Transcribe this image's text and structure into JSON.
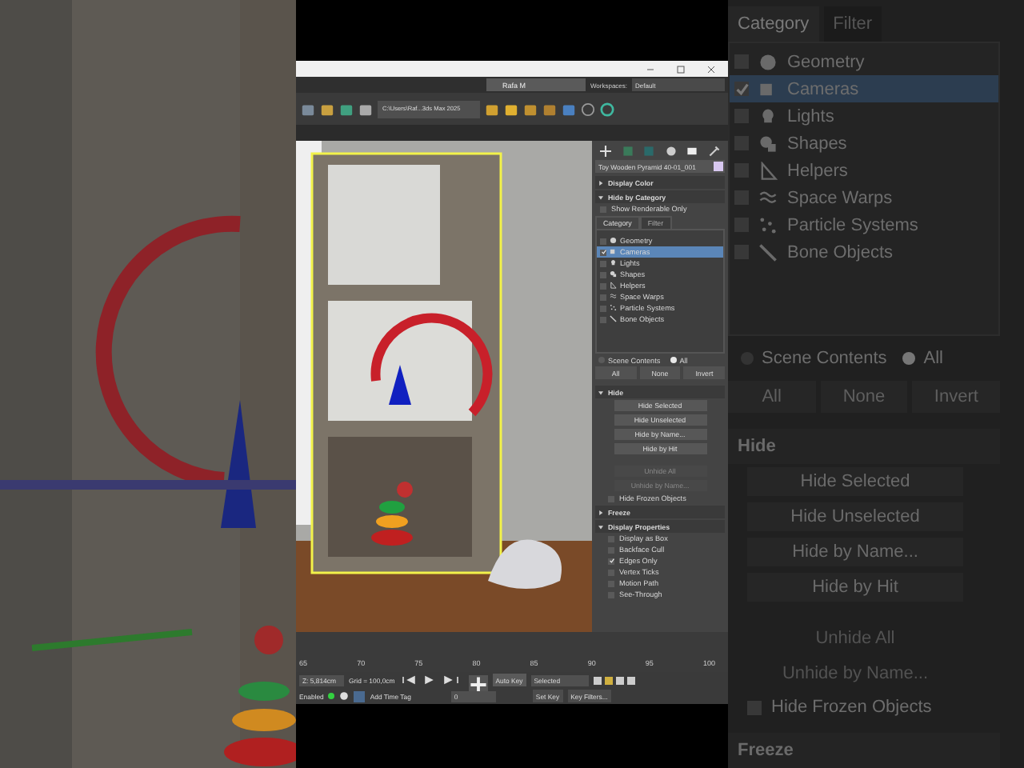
{
  "menu_bar": {
    "user": "Rafa M",
    "workspaces_label": "Workspaces:",
    "workspace": "Default"
  },
  "toolbar": {
    "project_path": "C:\\Users\\Raf...3ds Max 2025"
  },
  "command_panel": {
    "object_name": "Toy Wooden Pyramid 40-01_001",
    "rollouts": [
      {
        "title": "Display Color",
        "expanded": false
      },
      {
        "title": "Hide by Category",
        "expanded": true
      }
    ],
    "show_renderable_only": {
      "label": "Show Renderable Only",
      "checked": false
    },
    "tabs": [
      {
        "label": "Category",
        "selected": true
      },
      {
        "label": "Filter",
        "selected": false
      }
    ],
    "categories": [
      {
        "label": "Geometry",
        "checked": false,
        "selected": false
      },
      {
        "label": "Cameras",
        "checked": true,
        "selected": true
      },
      {
        "label": "Lights",
        "checked": false,
        "selected": false
      },
      {
        "label": "Shapes",
        "checked": false,
        "selected": false
      },
      {
        "label": "Helpers",
        "checked": false,
        "selected": false
      },
      {
        "label": "Space Warps",
        "checked": false,
        "selected": false
      },
      {
        "label": "Particle Systems",
        "checked": false,
        "selected": false
      },
      {
        "label": "Bone Objects",
        "checked": false,
        "selected": false
      }
    ],
    "scope": [
      {
        "label": "Scene Contents",
        "selected": false
      },
      {
        "label": "All",
        "selected": true
      }
    ],
    "select_buttons": [
      "All",
      "None",
      "Invert"
    ],
    "hide": {
      "title": "Hide",
      "expanded": true,
      "buttons": [
        {
          "label": "Hide Selected",
          "disabled": false
        },
        {
          "label": "Hide Unselected",
          "disabled": false
        },
        {
          "label": "Hide by Name...",
          "disabled": false
        },
        {
          "label": "Hide by Hit",
          "disabled": false
        },
        {
          "label": "Unhide All",
          "disabled": true
        },
        {
          "label": "Unhide by Name...",
          "disabled": true
        }
      ],
      "hide_frozen": {
        "label": "Hide Frozen Objects",
        "checked": false
      }
    },
    "freeze": {
      "title": "Freeze",
      "expanded": false
    },
    "display_properties": {
      "title": "Display Properties",
      "expanded": true,
      "options": [
        {
          "label": "Display as Box",
          "checked": false
        },
        {
          "label": "Backface Cull",
          "checked": false
        },
        {
          "label": "Edges Only",
          "checked": true
        },
        {
          "label": "Vertex Ticks",
          "checked": false
        },
        {
          "label": "Motion Path",
          "checked": false
        },
        {
          "label": "See-Through",
          "checked": false
        }
      ]
    }
  },
  "timeline": {
    "ticks": [
      "65",
      "70",
      "75",
      "80",
      "85",
      "90",
      "95",
      "100"
    ]
  },
  "status_bar": {
    "z_value": "Z: 5,814cm",
    "grid": "Grid = 100,0cm",
    "enabled": "Enabled",
    "add_time_tag": "Add Time Tag",
    "frame": "0",
    "auto_key": "Auto Key",
    "key_mode": "Selected",
    "set_key": "Set Key",
    "key_filters": "Key Filters..."
  },
  "backdrop_panel": {
    "tabs": [
      {
        "label": "Category",
        "selected": true
      },
      {
        "label": "Filter",
        "selected": false
      }
    ],
    "categories": [
      {
        "label": "Geometry",
        "checked": false,
        "selected": false
      },
      {
        "label": "Cameras",
        "checked": true,
        "selected": true
      },
      {
        "label": "Lights",
        "checked": false,
        "selected": false
      },
      {
        "label": "Shapes",
        "checked": false,
        "selected": false
      },
      {
        "label": "Helpers",
        "checked": false,
        "selected": false
      },
      {
        "label": "Space Warps",
        "checked": false,
        "selected": false
      },
      {
        "label": "Particle Systems",
        "checked": false,
        "selected": false
      },
      {
        "label": "Bone Objects",
        "checked": false,
        "selected": false
      }
    ],
    "scope": [
      {
        "label": "Scene Contents",
        "selected": false
      },
      {
        "label": "All",
        "selected": true
      }
    ],
    "select_buttons": [
      "All",
      "None",
      "Invert"
    ],
    "hide_title": "Hide",
    "hide_buttons": [
      {
        "label": "Hide Selected",
        "disabled": false
      },
      {
        "label": "Hide Unselected",
        "disabled": false
      },
      {
        "label": "Hide by Name...",
        "disabled": false
      },
      {
        "label": "Hide by Hit",
        "disabled": false
      },
      {
        "label": "Unhide All",
        "disabled": true
      },
      {
        "label": "Unhide by Name...",
        "disabled": true
      }
    ],
    "hide_frozen": {
      "label": "Hide Frozen Objects",
      "checked": false
    },
    "freeze_title": "Freeze"
  }
}
